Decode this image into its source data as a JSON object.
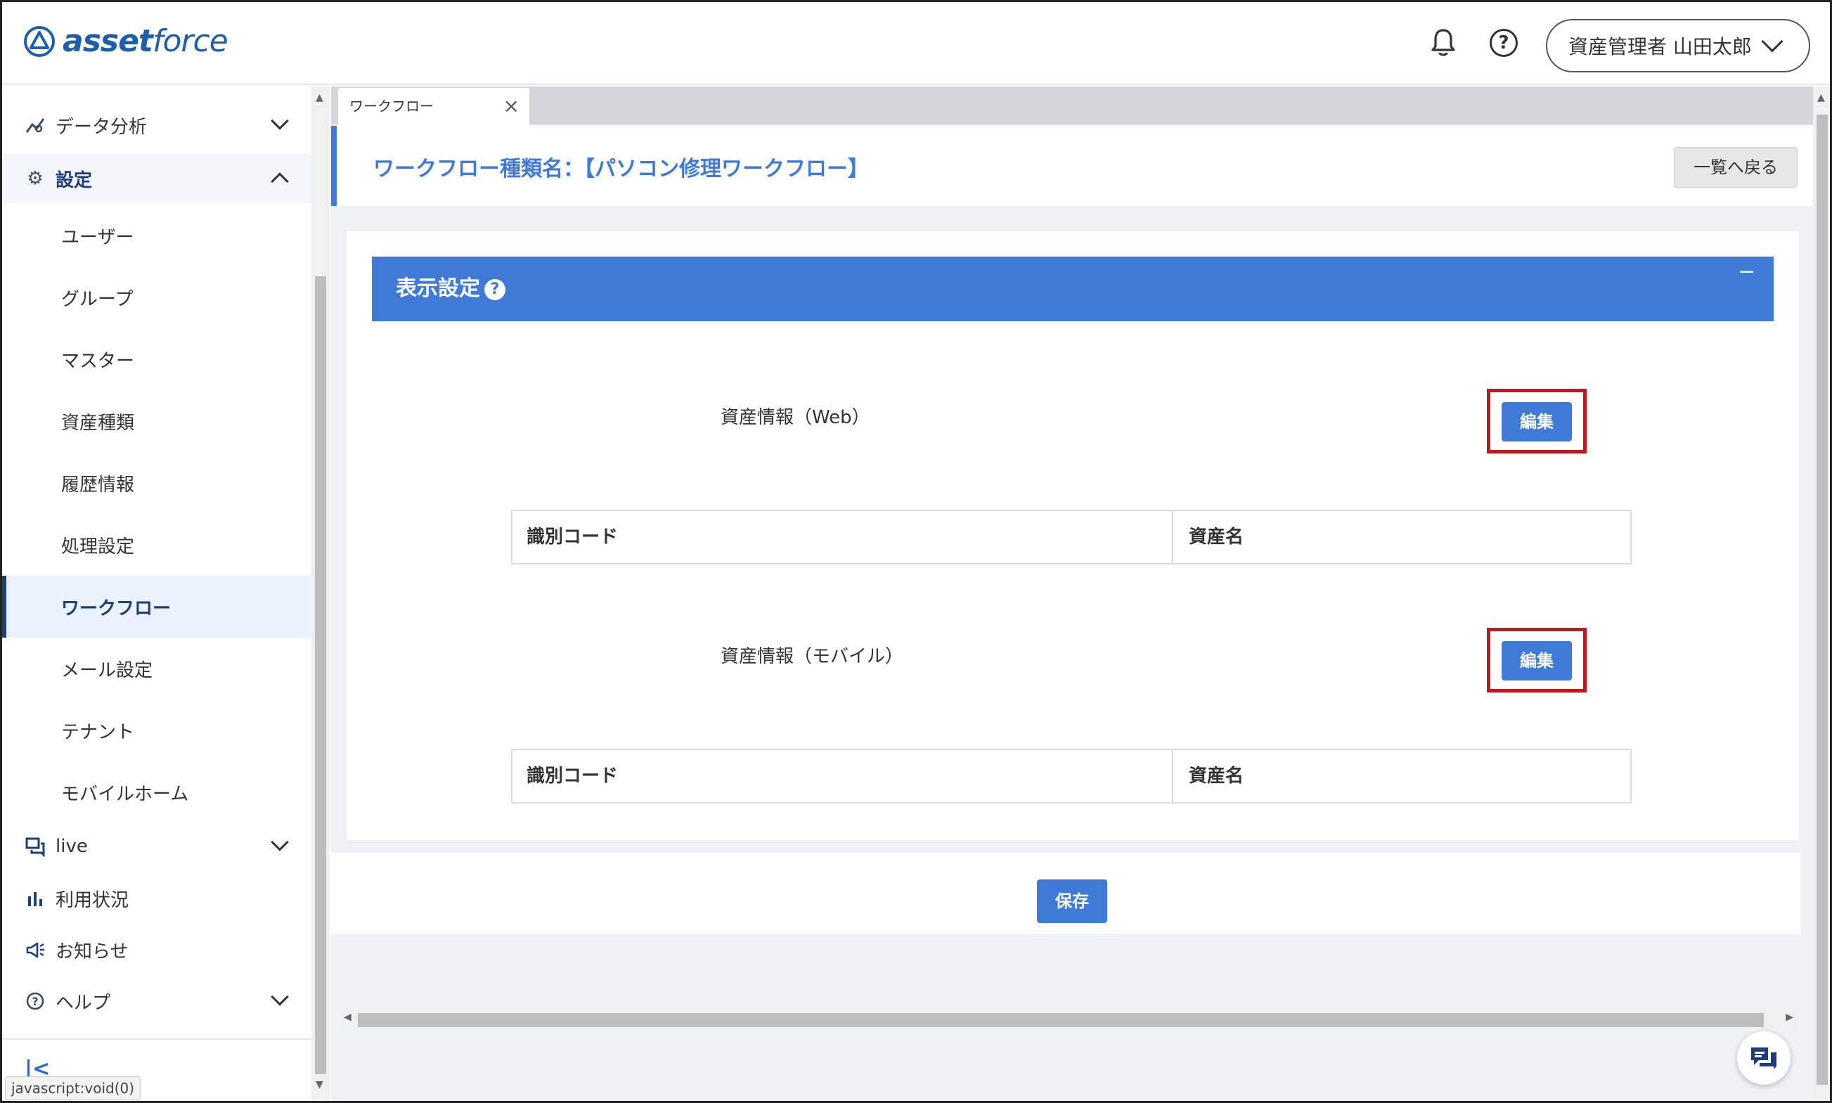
{
  "app": {
    "logo_text_bold": "asset",
    "logo_text_light": "force",
    "user_menu_label": "資産管理者 山田太郎",
    "help_symbol": "?"
  },
  "sidebar": {
    "top_items": [
      {
        "label": "データ分析",
        "icon": "analytics-icon",
        "state": "collapsed"
      },
      {
        "label": "設定",
        "icon": "gear-icon",
        "state": "expanded"
      }
    ],
    "sub_items": [
      {
        "label": "ユーザー"
      },
      {
        "label": "グループ"
      },
      {
        "label": "マスター"
      },
      {
        "label": "資産種類"
      },
      {
        "label": "履歴情報"
      },
      {
        "label": "処理設定"
      },
      {
        "label": "ワークフロー",
        "active": true
      },
      {
        "label": "メール設定"
      },
      {
        "label": "テナント"
      },
      {
        "label": "モバイルホーム"
      }
    ],
    "bottom_items": [
      {
        "label": "live",
        "icon": "chat-icon"
      },
      {
        "label": "利用状況",
        "icon": "bar-chart-icon"
      },
      {
        "label": "お知らせ",
        "icon": "megaphone-icon"
      },
      {
        "label": "ヘルプ",
        "icon": "help-circle-icon"
      }
    ],
    "collapse_symbol": "|<",
    "status_url": "javascript:void(0)"
  },
  "main": {
    "tab": {
      "label": "ワークフロー",
      "close_symbol": "×"
    },
    "page_title": "ワークフロー種類名：【パソコン修理ワークフロー】",
    "back_button": "一覧へ戻る",
    "section": {
      "title": "表示設定",
      "help_symbol": "?",
      "collapse_symbol": "−",
      "rows": [
        {
          "label": "資産情報（Web）",
          "edit_button": "編集",
          "columns": [
            "識別コード",
            "資産名"
          ]
        },
        {
          "label": "資産情報（モバイル）",
          "edit_button": "編集",
          "columns": [
            "識別コード",
            "資産名"
          ]
        }
      ]
    },
    "save_button": "保存"
  },
  "colors": {
    "accent": "#3f7bd6",
    "brand": "#1f5fa8",
    "highlight_frame": "#b81c22",
    "sidebar_active_bg": "#eaf2fd"
  }
}
